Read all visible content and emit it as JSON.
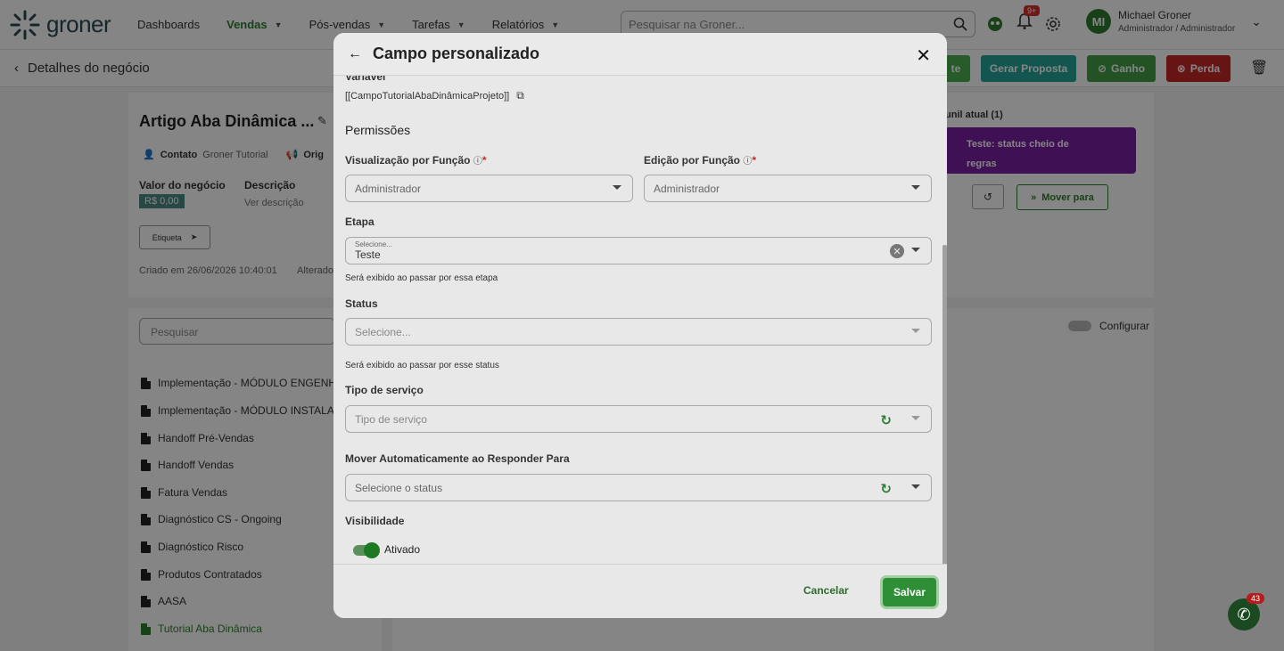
{
  "brand": {
    "name": "groner"
  },
  "nav": [
    {
      "label": "Dashboards",
      "caret": false,
      "active": false
    },
    {
      "label": "Vendas",
      "caret": true,
      "active": true
    },
    {
      "label": "Pós-vendas",
      "caret": true,
      "active": false
    },
    {
      "label": "Tarefas",
      "caret": true,
      "active": false
    },
    {
      "label": "Relatórios",
      "caret": true,
      "active": false
    }
  ],
  "search": {
    "placeholder": "Pesquisar na Groner..."
  },
  "notifications": {
    "count": "9+"
  },
  "user": {
    "initials": "MI",
    "name": "Michael Groner",
    "role": "Administrador / Administrador"
  },
  "subbar": {
    "back_label": "Detalhes do negócio"
  },
  "actions": {
    "gerar_proposta": "Gerar Proposta",
    "ganho": "Ganho",
    "perda": "Perda",
    "partial_left": "te"
  },
  "deal": {
    "title": "Artigo Aba Dinâmica ...",
    "contato_label": "Contato",
    "contato_value": "Groner Tutorial",
    "origem_label": "Orig",
    "valor_label": "Valor do negócio",
    "valor_value": "R$ 0,00",
    "descricao_label": "Descrição",
    "descricao_value": "Ver descrição",
    "etiqueta": "Etiqueta",
    "created": "Criado em 26/06/2026 10:40:01",
    "altered": "Alterado"
  },
  "funnel": {
    "label": "unil atual (1)",
    "card_text": "Teste: status cheio de regras",
    "mover_para": "Mover para",
    "configurar": "Configurar"
  },
  "sidebar_list": {
    "search_placeholder": "Pesquisar",
    "items": [
      "Implementação - MÓDULO ENGENHAR",
      "Implementação - MÓDULO INSTALAÇÃ",
      "Handoff Pré-Vendas",
      "Handoff Vendas",
      "Fatura Vendas",
      "Diagnóstico CS - Ongoing",
      "Diagnóstico Risco",
      "Produtos Contratados",
      "AASA",
      "Tutorial Aba Dinâmica"
    ]
  },
  "modal": {
    "title": "Campo personalizado",
    "variable_label": "Variável",
    "variable_value": "[[CampoTutorialAbaDinâmicaProjeto]]",
    "permissions_heading": "Permissões",
    "view_by_role_label": "Visualização por Função",
    "view_by_role_value": "Administrador",
    "edit_by_role_label": "Edição por Função",
    "edit_by_role_value": "Administrador",
    "required_mark": "*",
    "etapa_label": "Etapa",
    "etapa_placeholder": "Selecione...",
    "etapa_value": "Teste",
    "etapa_helper": "Será exibido ao passar por essa etapa",
    "status_label": "Status",
    "status_placeholder": "Selecione...",
    "status_helper": "Será exibido ao passar por esse status",
    "service_label": "Tipo de serviço",
    "service_placeholder": "Tipo de serviço",
    "move_label": "Mover Automaticamente ao Responder Para",
    "move_placeholder": "Selecione o status",
    "visibility_label": "Visibilidade",
    "visibility_value": "Ativado",
    "cancel": "Cancelar",
    "save": "Salvar"
  },
  "whatsapp": {
    "count": "43"
  }
}
